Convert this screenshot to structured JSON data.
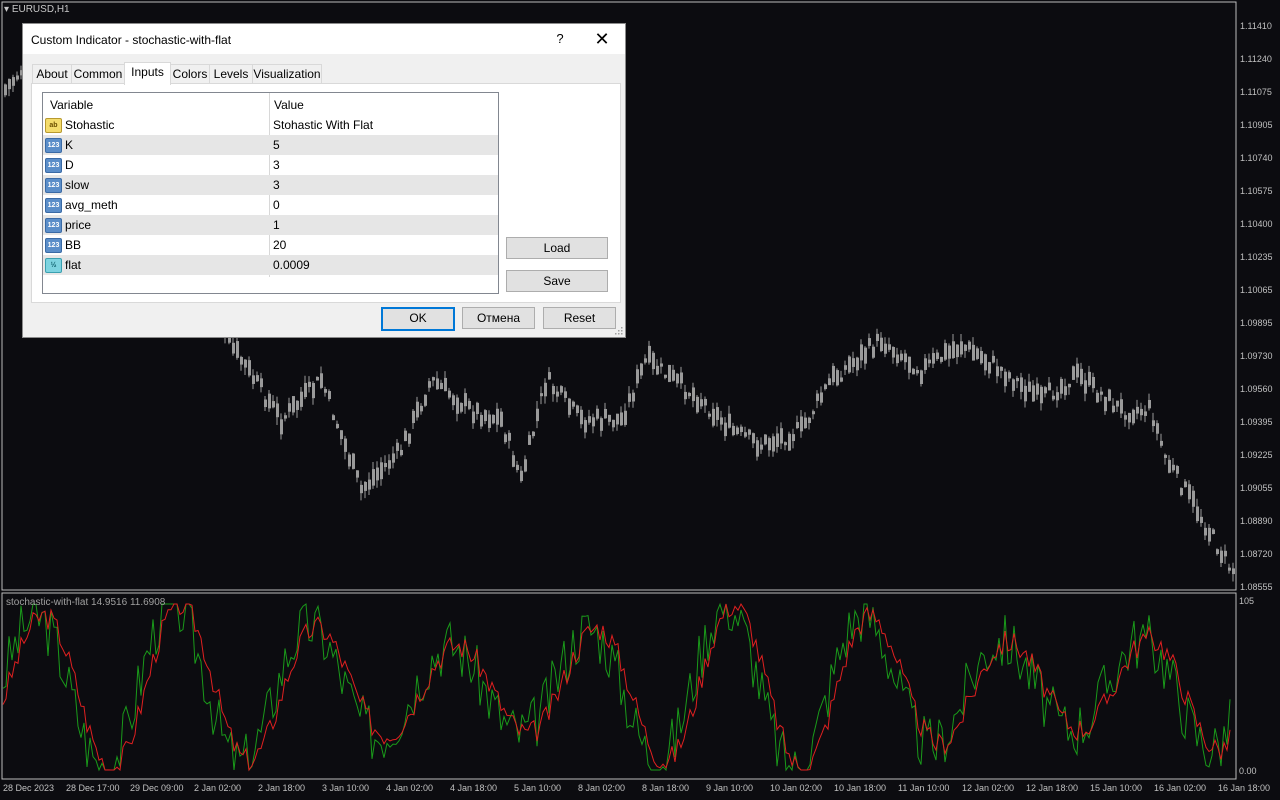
{
  "chart": {
    "symbol": "EURUSD,H1",
    "price_ticks": [
      "1.11410",
      "1.11240",
      "1.11075",
      "1.10905",
      "1.10740",
      "1.10575",
      "1.10400",
      "1.10235",
      "1.10065",
      "1.09895",
      "1.09730",
      "1.09560",
      "1.09395",
      "1.09225",
      "1.09055",
      "1.08890",
      "1.08720",
      "1.08555"
    ],
    "time_ticks": [
      "28 Dec 2023",
      "28 Dec 17:00",
      "29 Dec 09:00",
      "2 Jan 02:00",
      "2 Jan 18:00",
      "3 Jan 10:00",
      "4 Jan 02:00",
      "4 Jan 18:00",
      "5 Jan 10:00",
      "8 Jan 02:00",
      "8 Jan 18:00",
      "9 Jan 10:00",
      "10 Jan 02:00",
      "10 Jan 18:00",
      "11 Jan 10:00",
      "12 Jan 02:00",
      "12 Jan 18:00",
      "15 Jan 10:00",
      "16 Jan 02:00",
      "16 Jan 18:00"
    ],
    "indicator_label": "stochastic-with-flat 14.9516 11.6908",
    "indicator_max": "105",
    "indicator_min": "0.00",
    "colors": {
      "bg": "#0c0c10",
      "candles": "#9a9a9a",
      "main_line": "#1a9a1a",
      "signal_line": "#e02020"
    }
  },
  "dialog": {
    "title": "Custom Indicator - stochastic-with-flat",
    "help": "?",
    "close": "✕",
    "tabs": [
      "About",
      "Common",
      "Inputs",
      "Colors",
      "Levels",
      "Visualization"
    ],
    "active_tab": "Inputs",
    "grid": {
      "headers": {
        "variable": "Variable",
        "value": "Value"
      },
      "rows": [
        {
          "icon": "ab",
          "name": "Stohastic",
          "value": "Stohastic With Flat"
        },
        {
          "icon": "123",
          "name": "K",
          "value": "5"
        },
        {
          "icon": "123",
          "name": "D",
          "value": "3"
        },
        {
          "icon": "123",
          "name": "slow",
          "value": "3"
        },
        {
          "icon": "123",
          "name": "avg_meth",
          "value": "0"
        },
        {
          "icon": "123",
          "name": "price",
          "value": "1"
        },
        {
          "icon": "123",
          "name": "BB",
          "value": "20"
        },
        {
          "icon": "½",
          "name": "flat",
          "value": "0.0009"
        }
      ]
    },
    "buttons": {
      "load": "Load",
      "save": "Save",
      "ok": "OK",
      "cancel": "Отмена",
      "reset": "Reset"
    }
  }
}
